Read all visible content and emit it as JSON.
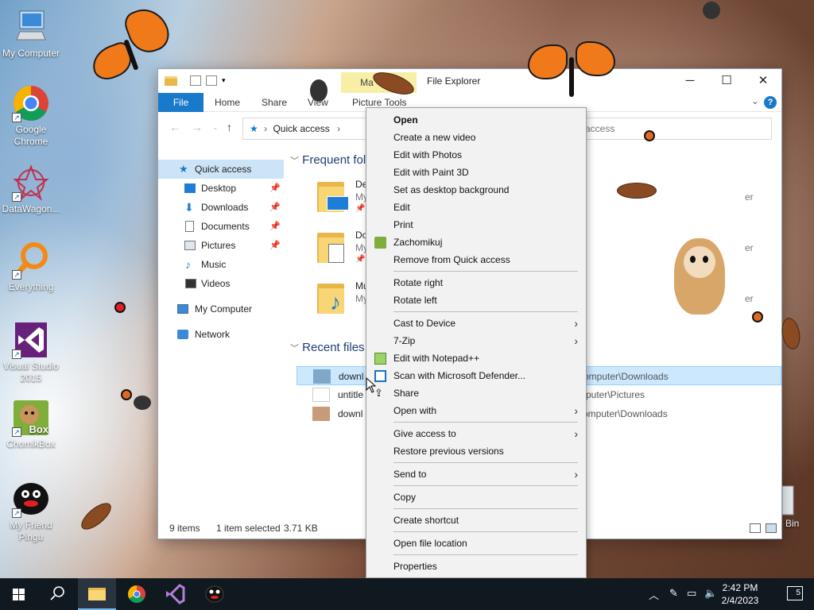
{
  "desktop": {
    "icons": [
      {
        "label": "My Computer"
      },
      {
        "label": "Google Chrome"
      },
      {
        "label": "DataWagon..."
      },
      {
        "label": "Everything"
      },
      {
        "label": "Visual Studio 2015"
      },
      {
        "label": "ChomikBox",
        "badge": "Box"
      },
      {
        "label": "My Friend Pingu"
      }
    ],
    "recycle_bin_partial": "Bin"
  },
  "explorer": {
    "title": "File Explorer",
    "manage_tab": "Manage",
    "manage_tab_visible": "Ma",
    "ribbon_tabs": [
      "File",
      "Home",
      "Share",
      "View",
      "Picture Tools"
    ],
    "address": {
      "root": "Quick access"
    },
    "search_visible": "access",
    "nav": [
      {
        "label": "Quick access",
        "selected": true
      },
      {
        "label": "Desktop",
        "pinned": true
      },
      {
        "label": "Downloads",
        "pinned": true
      },
      {
        "label": "Documents",
        "pinned": true
      },
      {
        "label": "Pictures",
        "pinned": true
      },
      {
        "label": "Music"
      },
      {
        "label": "Videos"
      },
      {
        "label": "My Computer"
      },
      {
        "label": "Network"
      }
    ],
    "frequent_header": "Frequent fol",
    "frequent": [
      {
        "name": "De",
        "sub": "My",
        "right": "er"
      },
      {
        "name": "Do",
        "sub": "My",
        "right": "er"
      },
      {
        "name": "Mu",
        "sub": "My",
        "right": "er"
      }
    ],
    "recent_header": "Recent files",
    "recent": [
      {
        "name": "downl",
        "path": "omputer\\Downloads",
        "selected": true
      },
      {
        "name": "untitle",
        "path": "puter\\Pictures"
      },
      {
        "name": "downl",
        "path": "omputer\\Downloads"
      }
    ],
    "status": {
      "items": "9 items",
      "selected": "1 item selected",
      "size": "3.71 KB"
    }
  },
  "context_menu": {
    "groups": [
      [
        {
          "label": "Open",
          "bold": true
        },
        {
          "label": "Create a new video"
        },
        {
          "label": "Edit with Photos"
        },
        {
          "label": "Edit with Paint 3D"
        },
        {
          "label": "Set as desktop background"
        },
        {
          "label": "Edit"
        },
        {
          "label": "Print"
        },
        {
          "label": "Zachomikuj",
          "icon": "chomikbox-icon"
        },
        {
          "label": "Remove from Quick access"
        }
      ],
      [
        {
          "label": "Rotate right"
        },
        {
          "label": "Rotate left"
        }
      ],
      [
        {
          "label": "Cast to Device",
          "submenu": true
        },
        {
          "label": "7-Zip",
          "submenu": true
        },
        {
          "label": "Edit with Notepad++",
          "icon": "notepadpp-icon"
        },
        {
          "label": "Scan with Microsoft Defender...",
          "icon": "defender-icon"
        },
        {
          "label": "Share",
          "icon": "share-icon"
        },
        {
          "label": "Open with",
          "submenu": true
        }
      ],
      [
        {
          "label": "Give access to",
          "submenu": true
        },
        {
          "label": "Restore previous versions"
        }
      ],
      [
        {
          "label": "Send to",
          "submenu": true
        }
      ],
      [
        {
          "label": "Copy"
        }
      ],
      [
        {
          "label": "Create shortcut"
        }
      ],
      [
        {
          "label": "Open file location"
        }
      ],
      [
        {
          "label": "Properties"
        }
      ]
    ]
  },
  "taskbar": {
    "time": "2:42 PM",
    "date": "2/4/2023",
    "notifications": "5"
  }
}
